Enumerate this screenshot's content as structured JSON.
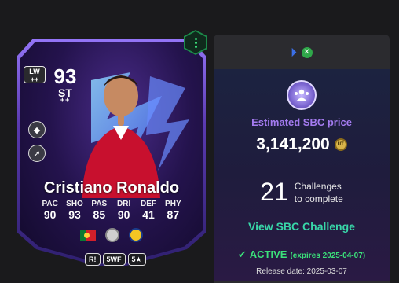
{
  "card": {
    "rating": "93",
    "position": "ST",
    "position_plus": "++",
    "alt_position": "LW",
    "alt_position_plus": "++",
    "name": "Cristiano Ronaldo",
    "stats": [
      {
        "label": "PAC",
        "value": "90"
      },
      {
        "label": "SHO",
        "value": "93"
      },
      {
        "label": "PAS",
        "value": "85"
      },
      {
        "label": "DRI",
        "value": "90"
      },
      {
        "label": "DEF",
        "value": "41"
      },
      {
        "label": "PHY",
        "value": "87"
      }
    ],
    "chips": {
      "r": "R!",
      "weakfoot": "5WF",
      "skills": "5★"
    }
  },
  "panel": {
    "sbc_label": "Estimated SBC price",
    "price": "3,141,200",
    "coin_label": "UT",
    "challenge_count": "21",
    "challenge_text_line1": "Challenges",
    "challenge_text_line2": "to complete",
    "view_link": "View SBC Challenge",
    "active_label": "ACTIVE",
    "expires": "(expires 2025-04-07)",
    "release": "Release date: 2025-03-07"
  },
  "colors": {
    "accent_purple": "#a47bf0",
    "link_teal": "#38d6a8",
    "active_green": "#3be07a"
  },
  "icons": [
    "playstation-icon",
    "xbox-icon",
    "sbc-group-icon",
    "coin-icon",
    "check-icon",
    "evolution-icon",
    "playstyle-icon-1",
    "playstyle-icon-2"
  ]
}
